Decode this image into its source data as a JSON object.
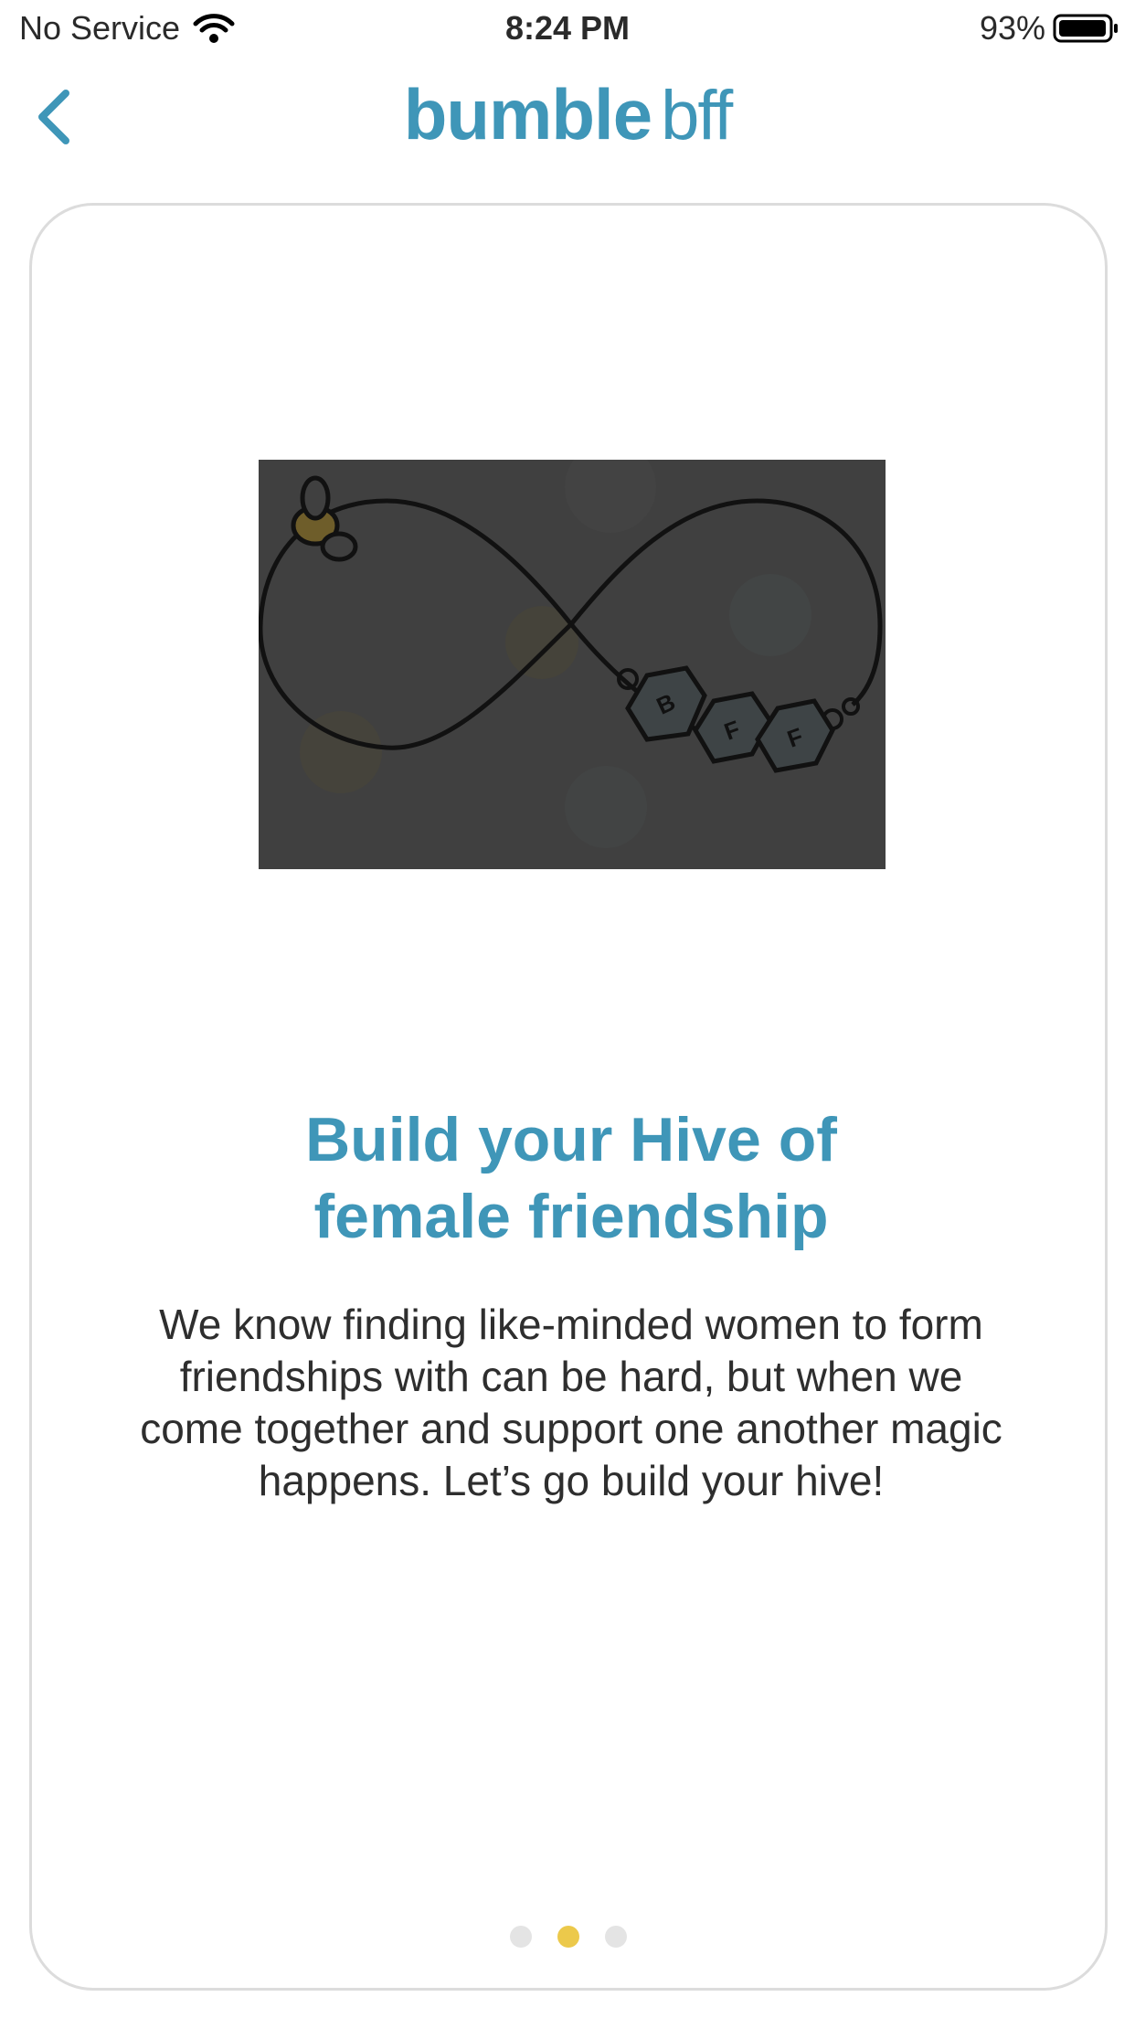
{
  "status_bar": {
    "carrier": "No Service",
    "time": "8:24 PM",
    "battery": "93%"
  },
  "header": {
    "back_icon": "chevron-left-icon",
    "logo_primary": "bumble",
    "logo_secondary": "bff",
    "accent_color": "#3f96b8"
  },
  "onboarding": {
    "illustration": {
      "icon": "infinity-bracelet-bee-illustration",
      "bead_letters": [
        "B",
        "F",
        "F"
      ]
    },
    "title_line1": "Build your Hive of",
    "title_line2": "female friendship",
    "body_line1": "We know finding like-minded women to form",
    "body_line2": "friendships with can be hard, but when we",
    "body_line3": "come together and support one another magic",
    "body_line4": "happens. Let’s go build your hive!",
    "pager": {
      "total": 3,
      "current": 2,
      "active_color": "#ecc94b",
      "inactive_color": "#e4e4e4"
    }
  }
}
